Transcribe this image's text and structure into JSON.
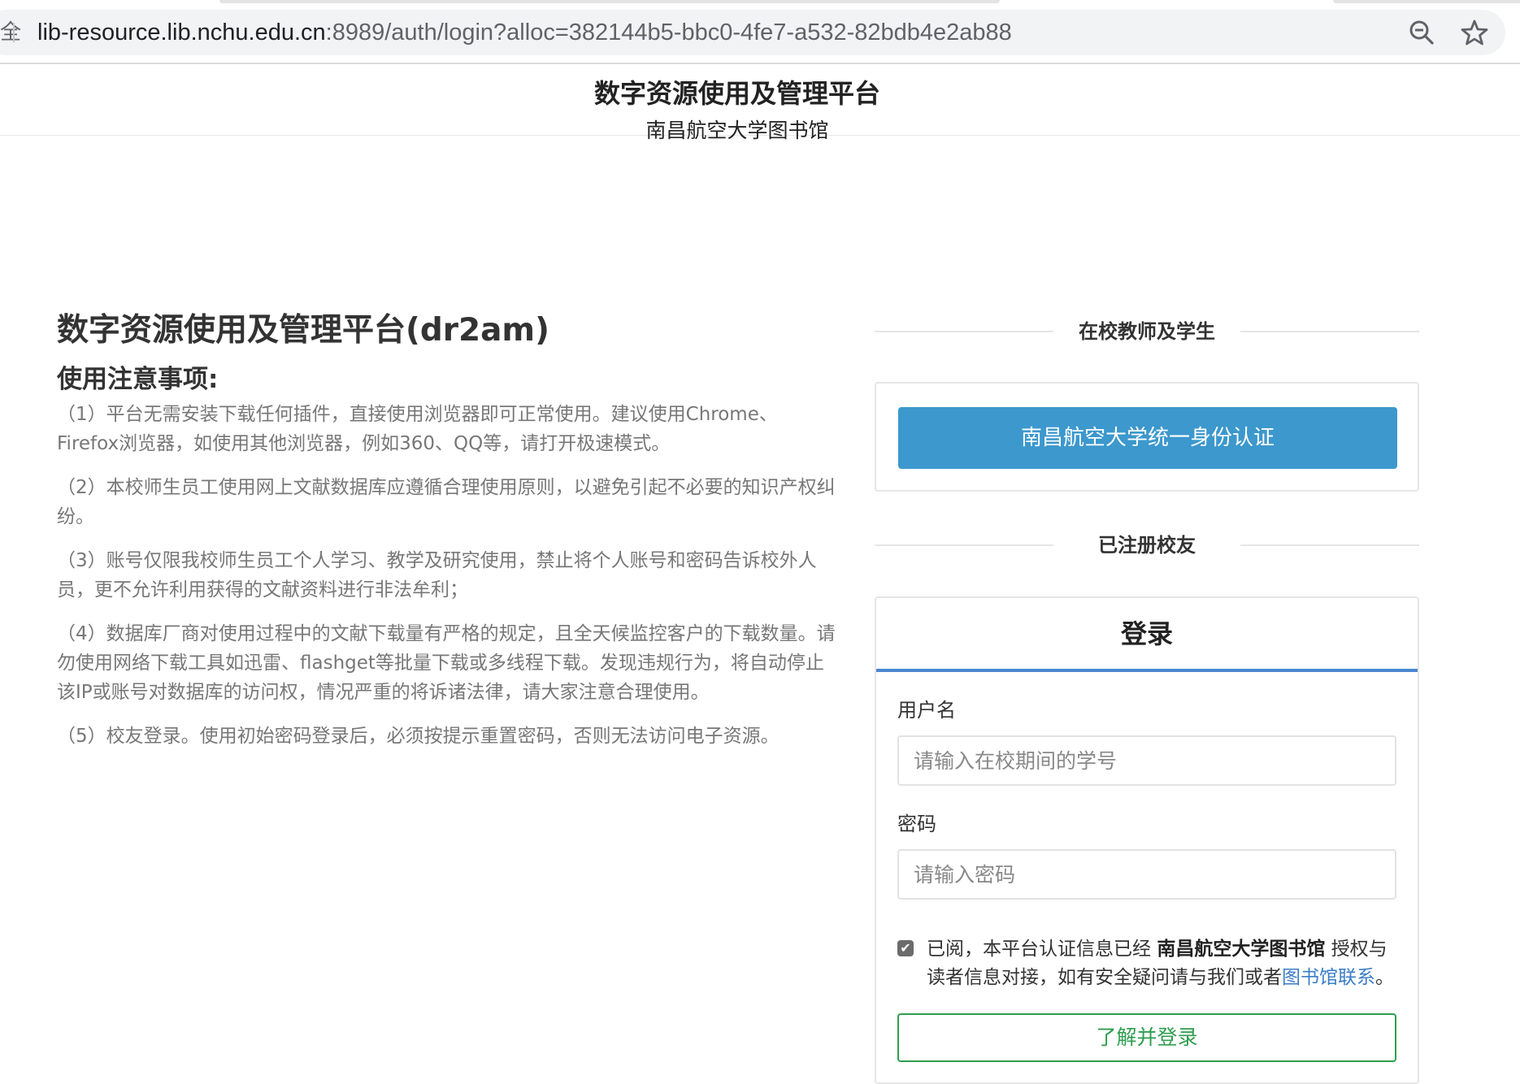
{
  "browser": {
    "url_host": "lib-resource.lib.nchu.edu.cn",
    "url_rest": ":8989/auth/login?alloc=382144b5-bbc0-4fe7-a532-82bdb4e2ab88",
    "lock_glyph": "全",
    "icons": [
      "zoom-icon",
      "star-icon"
    ]
  },
  "header": {
    "title": "数字资源使用及管理平台",
    "subtitle": "南昌航空大学图书馆"
  },
  "notice": {
    "main_title": "数字资源使用及管理平台(dr2am)",
    "heading": "使用注意事项:",
    "items": [
      "（1）平台无需安装下载任何插件，直接使用浏览器即可正常使用。建议使用Chrome、Firefox浏览器，如使用其他浏览器，例如360、QQ等，请打开极速模式。",
      "（2）本校师生员工使用网上文献数据库应遵循合理使用原则，以避免引起不必要的知识产权纠纷。",
      "（3）账号仅限我校师生员工个人学习、教学及研究使用，禁止将个人账号和密码告诉校外人员，更不允许利用获得的文献资料进行非法牟利；",
      "（4）数据库厂商对使用过程中的文献下载量有严格的规定，且全天候监控客户的下载数量。请勿使用网络下载工具如迅雷、flashget等批量下载或多线程下载。发现违规行为，将自动停止该IP或账号对数据库的访问权，情况严重的将诉诸法律，请大家注意合理使用。",
      "（5）校友登录。使用初始密码登录后，必须按提示重置密码，否则无法访问电子资源。"
    ]
  },
  "sso": {
    "section_title": "在校教师及学生",
    "button_label": "南昌航空大学统一身份认证",
    "button_color": "#3c98cd"
  },
  "alumni": {
    "section_title": "已注册校友",
    "login_title": "登录",
    "username_label": "用户名",
    "username_placeholder": "请输入在校期间的学号",
    "password_label": "密码",
    "password_placeholder": "请输入密码",
    "agree_checked": true,
    "agree_prefix": "已阅，本平台认证信息已经 ",
    "agree_org": "南昌航空大学图书馆",
    "agree_middle": " 授权与读者信息对接，如有安全疑问请与我们或者",
    "agree_link": "图书馆联系",
    "agree_suffix": "。",
    "confirm_label": "了解并登录",
    "confirm_color": "#2f9e4f",
    "accent_color": "#4a86d0"
  }
}
